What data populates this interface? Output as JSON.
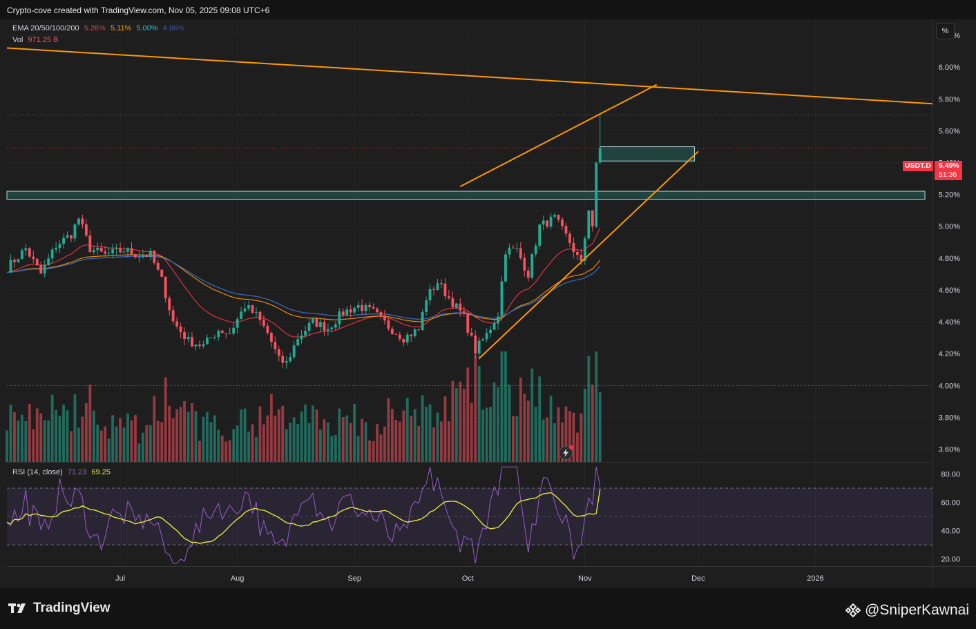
{
  "header": {
    "caption": "Crypto-cove created with TradingView.com, Nov 05, 2025 09:08 UTC+6"
  },
  "legend": {
    "ema_label": "EMA 20/50/100/200",
    "ema_values": [
      "5.26%",
      "5.11%",
      "5.00%",
      "4.86%"
    ],
    "ema_colors": [
      "#f23645",
      "#ff9800",
      "#26c6da",
      "#3f51b5"
    ],
    "vol_label": "Vol",
    "vol_value": "971.25 B",
    "rsi_label": "RSI (14, close)",
    "rsi_values": [
      "71.23",
      "69.25"
    ],
    "rsi_colors": [
      "#9c5ccf",
      "#e6e63c"
    ]
  },
  "scale_button": "%",
  "symbol_tag": {
    "symbol": "USDT.D",
    "price": "5.49%",
    "countdown": "51:36"
  },
  "branding": {
    "logo_text": "TradingView",
    "watermark": "@SniperKawnai"
  },
  "chart_data": [
    {
      "type": "candlestick",
      "symbol": "USDT.D",
      "y_axis": {
        "unit": "%",
        "range": [
          3.52,
          6.3
        ],
        "ticks": [
          "6.20%",
          "6.00%",
          "5.80%",
          "5.60%",
          "5.40%",
          "5.20%",
          "5.00%",
          "4.80%",
          "4.60%",
          "4.40%",
          "4.20%",
          "4.00%",
          "3.80%",
          "3.60%"
        ]
      },
      "x_axis": {
        "ticks": [
          "Jul",
          "Aug",
          "Sep",
          "Oct",
          "Nov",
          "Dec",
          "2026"
        ],
        "range": [
          "2025-06-01",
          "2026-02-01"
        ]
      },
      "close_path": [
        [
          "2025-06-01",
          4.74
        ],
        [
          "2025-06-06",
          4.86
        ],
        [
          "2025-06-10",
          4.7
        ],
        [
          "2025-06-14",
          4.88
        ],
        [
          "2025-06-18",
          4.95
        ],
        [
          "2025-06-20",
          5.05
        ],
        [
          "2025-06-23",
          4.86
        ],
        [
          "2025-06-27",
          4.82
        ],
        [
          "2025-07-02",
          4.85
        ],
        [
          "2025-07-06",
          4.82
        ],
        [
          "2025-07-09",
          4.82
        ],
        [
          "2025-07-12",
          4.66
        ],
        [
          "2025-07-15",
          4.4
        ],
        [
          "2025-07-19",
          4.28
        ],
        [
          "2025-07-23",
          4.25
        ],
        [
          "2025-07-27",
          4.35
        ],
        [
          "2025-07-30",
          4.33
        ],
        [
          "2025-08-03",
          4.5
        ],
        [
          "2025-08-06",
          4.44
        ],
        [
          "2025-08-09",
          4.33
        ],
        [
          "2025-08-12",
          4.16
        ],
        [
          "2025-08-14",
          4.14
        ],
        [
          "2025-08-17",
          4.3
        ],
        [
          "2025-08-21",
          4.4
        ],
        [
          "2025-08-25",
          4.36
        ],
        [
          "2025-08-29",
          4.46
        ],
        [
          "2025-09-02",
          4.5
        ],
        [
          "2025-09-06",
          4.46
        ],
        [
          "2025-09-10",
          4.37
        ],
        [
          "2025-09-14",
          4.3
        ],
        [
          "2025-09-18",
          4.35
        ],
        [
          "2025-09-20",
          4.55
        ],
        [
          "2025-09-23",
          4.65
        ],
        [
          "2025-09-26",
          4.55
        ],
        [
          "2025-09-30",
          4.43
        ],
        [
          "2025-10-03",
          4.22
        ],
        [
          "2025-10-06",
          4.32
        ],
        [
          "2025-10-09",
          4.45
        ],
        [
          "2025-10-11",
          4.85
        ],
        [
          "2025-10-14",
          4.85
        ],
        [
          "2025-10-17",
          4.7
        ],
        [
          "2025-10-20",
          5.0
        ],
        [
          "2025-10-24",
          5.05
        ],
        [
          "2025-10-28",
          4.9
        ],
        [
          "2025-10-31",
          4.76
        ],
        [
          "2025-11-02",
          5.1
        ],
        [
          "2025-11-03",
          5.0
        ],
        [
          "2025-11-04",
          5.4
        ],
        [
          "2025-11-05",
          5.49
        ]
      ],
      "ema": [
        {
          "name": "EMA 20",
          "color": "#f23645",
          "last": 5.26
        },
        {
          "name": "EMA 50",
          "color": "#ff9800",
          "last": 5.11
        },
        {
          "name": "EMA 100",
          "color": "#26c6da",
          "last": 5.0
        },
        {
          "name": "EMA 200",
          "color": "#3f51b5",
          "last": 4.86
        }
      ],
      "last_price": 5.49,
      "session_high": 5.7,
      "reference_level": 4.0,
      "trendlines": [
        {
          "from": [
            "2025-06-01",
            6.12
          ],
          "to": [
            "2026-02-01",
            5.77
          ],
          "color": "#ff9800"
        },
        {
          "from": [
            "2025-09-29",
            5.25
          ],
          "to": [
            "2025-11-20",
            5.89
          ],
          "color": "#ff9800"
        },
        {
          "from": [
            "2025-10-04",
            4.17
          ],
          "to": [
            "2025-12-01",
            5.47
          ],
          "color": "#ff9800"
        }
      ],
      "zones": [
        {
          "from": "2025-06-01",
          "to": "2026-01-30",
          "top": 5.22,
          "bottom": 5.17
        },
        {
          "from": "2025-11-05",
          "to": "2025-11-30",
          "top": 5.5,
          "bottom": 5.41
        }
      ]
    },
    {
      "type": "bar",
      "name": "Vol",
      "last": "971.25 B",
      "colors": {
        "up": "#22ab94",
        "down": "#f7525f"
      }
    },
    {
      "type": "line",
      "name": "RSI (14, close)",
      "y_axis": {
        "range": [
          15,
          88
        ],
        "ticks": [
          "80.00",
          "60.00",
          "40.00",
          "20.00"
        ]
      },
      "bands": [
        70,
        50,
        30
      ],
      "series": [
        {
          "name": "RSI",
          "color": "#9c5ccf",
          "last": 71.23
        },
        {
          "name": "MA",
          "color": "#e6e63c",
          "last": 69.25
        }
      ]
    }
  ]
}
